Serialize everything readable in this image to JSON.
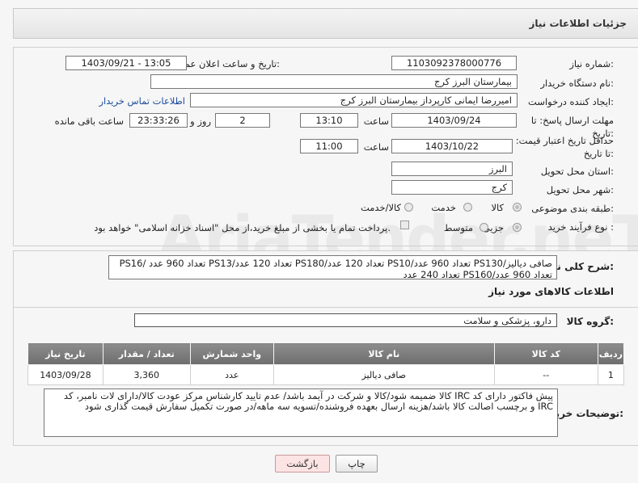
{
  "header": {
    "title": "جزئیات اطلاعات نیاز"
  },
  "labels": {
    "need_number": "شماره نیاز:",
    "announce_datetime": "تاریخ و ساعت اعلان عمومی:",
    "buyer_org": "نام دستگاه خریدار:",
    "requester": "ایجاد کننده درخواست:",
    "contact_link": "اطلاعات تماس خریدار",
    "reply_deadline": "مهلت ارسال پاسخ: تا تاریخ:",
    "time_word": "ساعت",
    "day_word": "روز و",
    "remaining_word": "ساعت باقی مانده",
    "price_validity": "حداقل تاریخ اعتبار قیمت: تا تاریخ:",
    "province": "استان محل تحویل:",
    "city": "شهر محل تحویل:",
    "category": "طبقه بندی موضوعی:",
    "process_type": "نوع فرآیند خرید :",
    "summary": "شرح کلی نیاز:",
    "goods_info": "اطلاعات کالاهای مورد نیاز",
    "goods_group": "گروه کالا:",
    "buyer_notes": "توضیحات خریدار:"
  },
  "values": {
    "need_number": "1103092378000776",
    "announce_datetime": "1403/09/21 - 13:05",
    "buyer_org": "بیمارستان البرز کرج",
    "requester": "امیررضا ایمانی کارپرداز بیمارستان البرز کرج",
    "reply_date": "1403/09/24",
    "reply_time": "13:10",
    "reply_days": "2",
    "reply_remaining": "23:33:26",
    "validity_date": "1403/10/22",
    "validity_time": "11:00",
    "province": "البرز",
    "city": "کرج",
    "summary": "صافی دیالیز/PS130 تعداد 960 عدد/PS10 تعداد 120 عدد/PS180 تعداد 120 عدد/PS13 تعداد 960 عدد /PS16 تعداد 960 عدد/PS160 تعداد 240 عدد",
    "goods_group": "دارو، پزشکی و سلامت",
    "buyer_notes": "پیش فاکتور دارای کد IRC کالا ضمیمه شود/کالا و شرکت در آیمد باشد/ عدم تایید کارشناس مرکز عودت کالا/دارای لات نامبر، کد IRC و برچسب اصالت کالا باشد/هزینه ارسال بعهده فروشنده/تسویه سه ماهه/در صورت تکمیل سفارش قیمت گذاری شود"
  },
  "category_options": {
    "goods": "کالا",
    "service": "خدمت",
    "goods_service": "کالا/خدمت"
  },
  "process_options": {
    "partial": "جزیی",
    "medium": "متوسط",
    "treasury_note": "پرداخت تمام یا بخشی از مبلغ خرید،از محل \"اسناد خزانه اسلامی\" خواهد بود."
  },
  "goods_table": {
    "headers": [
      "ردیف",
      "کد کالا",
      "نام کالا",
      "واحد شمارش",
      "تعداد / مقدار",
      "تاریخ نیاز"
    ],
    "rows": [
      {
        "row": "1",
        "code": "--",
        "name": "صافی دیالیز",
        "unit": "عدد",
        "qty": "3,360",
        "date": "1403/09/28"
      }
    ]
  },
  "buttons": {
    "print": "چاپ",
    "back": "بازگشت"
  },
  "watermark": "AriaTender.neT"
}
